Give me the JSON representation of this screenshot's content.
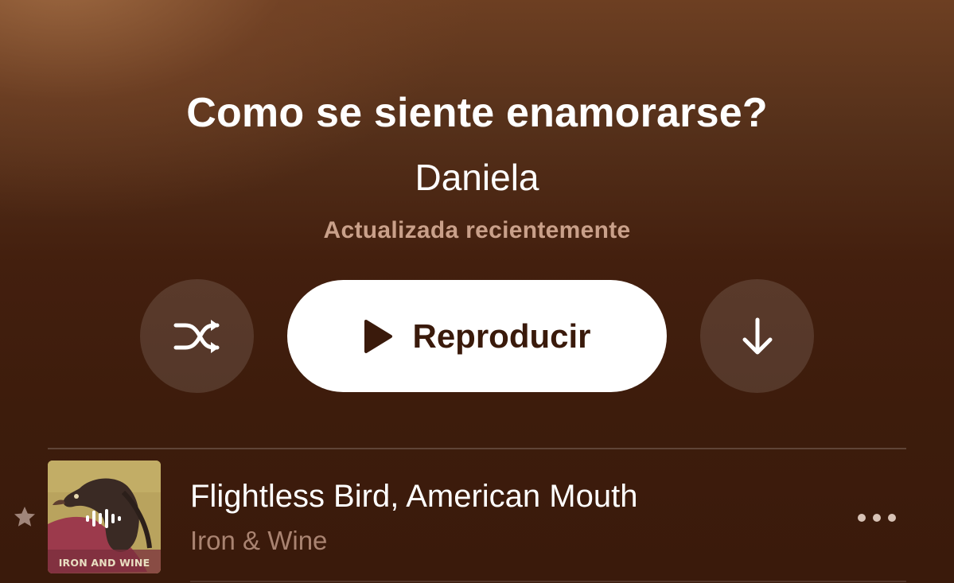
{
  "playlist": {
    "title": "Como se siente enamorarse?",
    "owner": "Daniela",
    "updated_text": "Actualizada recientemente"
  },
  "controls": {
    "shuffle_icon": "shuffle-icon",
    "play_label": "Reproducir",
    "play_icon": "play-icon",
    "download_icon": "arrow-down-icon"
  },
  "tracks": [
    {
      "title": "Flightless Bird, American Mouth",
      "artist": "Iron & Wine",
      "artwork_text": "IRON AND WINE",
      "favorited": true,
      "now_playing": true
    }
  ],
  "colors": {
    "background_top": "#6d3f22",
    "background_bottom": "#3a1a0b",
    "subtitle": "#c9a08a",
    "artist_text": "#a98371",
    "play_button_bg": "#ffffff",
    "play_button_text": "#3a1a0b"
  }
}
